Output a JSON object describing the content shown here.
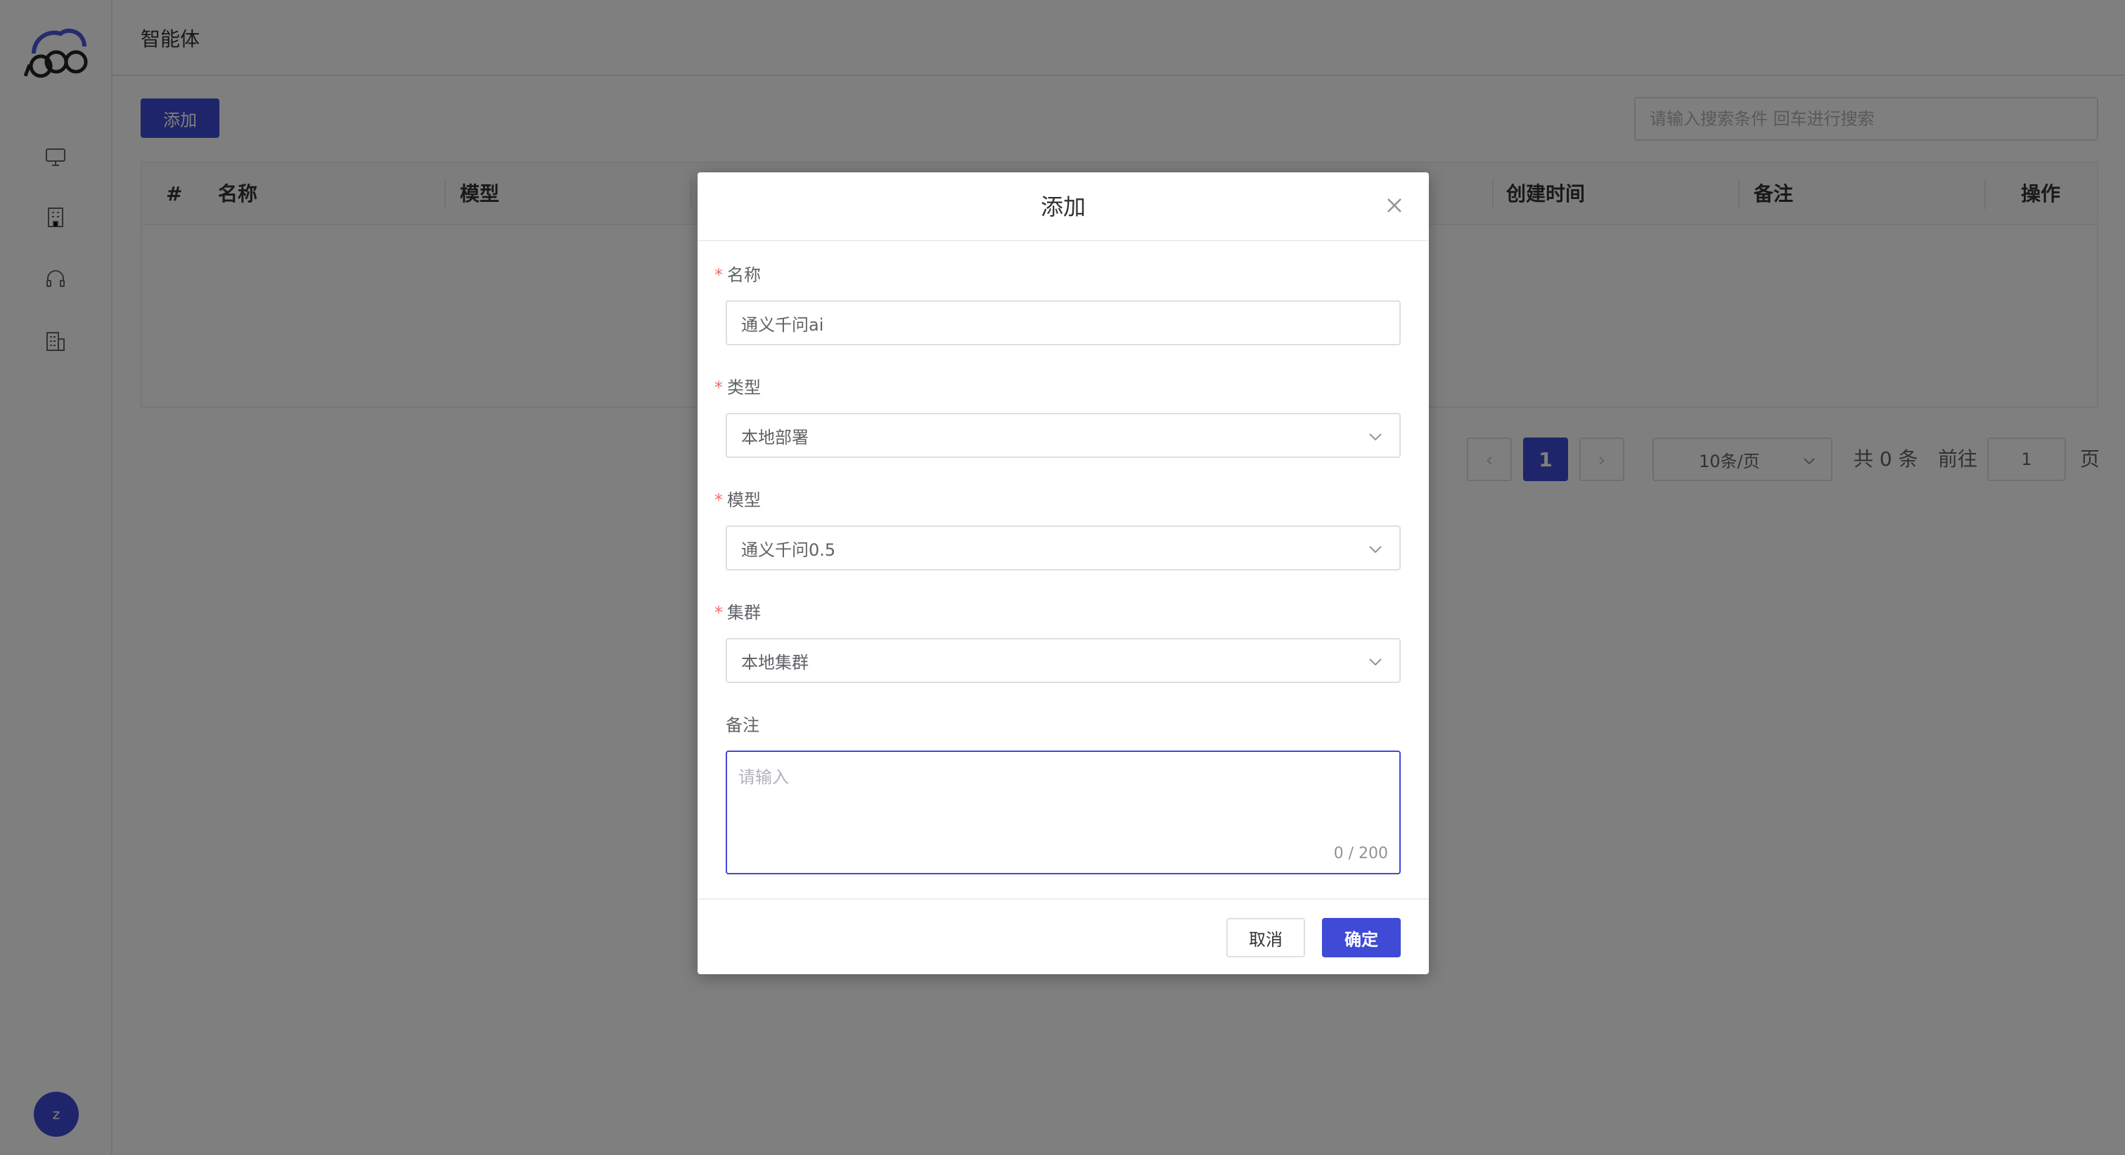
{
  "header": {
    "title": "智能体"
  },
  "toolbar": {
    "add_label": "添加",
    "search_placeholder": "请输入搜索条件 回车进行搜索"
  },
  "table": {
    "columns": [
      "#",
      "名称",
      "模型",
      "创建时间",
      "备注",
      "操作"
    ]
  },
  "pagination": {
    "current": "1",
    "page_size": "10条/页",
    "total": "共 0 条",
    "goto_prefix": "前往",
    "goto_value": "1",
    "goto_suffix": "页"
  },
  "user": {
    "avatar_letter": "z"
  },
  "dialog": {
    "title": "添加",
    "fields": {
      "name": {
        "label": "名称",
        "value": "通义千问ai"
      },
      "type": {
        "label": "类型",
        "value": "本地部署"
      },
      "model": {
        "label": "模型",
        "value": "通义千问0.5"
      },
      "cluster": {
        "label": "集群",
        "value": "本地集群"
      },
      "remark": {
        "label": "备注",
        "placeholder": "请输入",
        "counter": "0 / 200"
      }
    },
    "cancel_label": "取消",
    "ok_label": "确定"
  },
  "colors": {
    "primary": "#3f4ad6",
    "required": "#f56c6c",
    "mask": "rgba(0,0,0,0.5)"
  }
}
